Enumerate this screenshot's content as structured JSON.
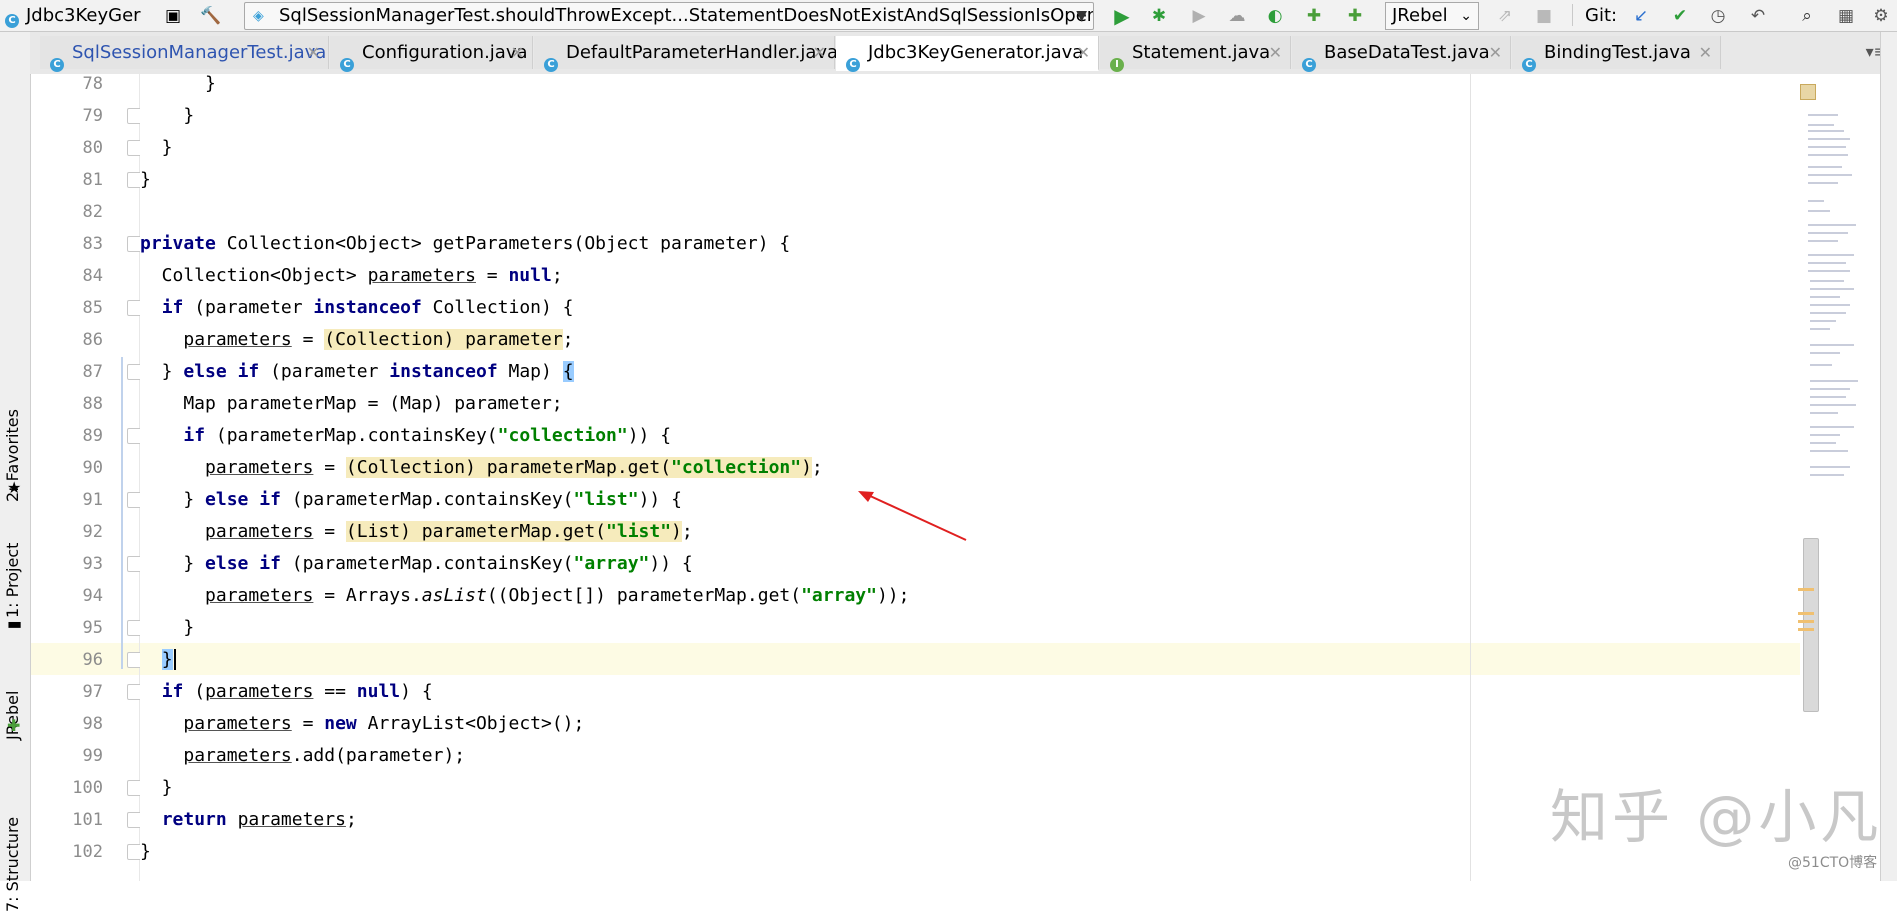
{
  "toolbar": {
    "window_title": "Jdbc3KeyGer",
    "run_config": "SqlSessionManagerTest.shouldThrowExcept...StatementDoesNotExistAndSqlSessionIsOpen",
    "jrebel_select": "JRebel",
    "git_label": "Git:"
  },
  "tabs": [
    {
      "label": "SqlSessionManagerTest.java",
      "icon": "class-icon",
      "active": false
    },
    {
      "label": "Configuration.java",
      "icon": "class-icon",
      "active": false
    },
    {
      "label": "DefaultParameterHandler.java",
      "icon": "class-icon",
      "active": false
    },
    {
      "label": "Jdbc3KeyGenerator.java",
      "icon": "class-icon",
      "active": true
    },
    {
      "label": "Statement.java",
      "icon": "interface-icon",
      "active": false
    },
    {
      "label": "BaseDataTest.java",
      "icon": "class-icon",
      "active": false
    },
    {
      "label": "BindingTest.java",
      "icon": "class-icon",
      "active": false
    }
  ],
  "left_tools": {
    "favorites": "2: Favorites",
    "project": "1: Project",
    "jrebel": "JRebel",
    "structure": "7: Structure"
  },
  "editor": {
    "current_line": 96,
    "lines": [
      {
        "n": "78",
        "text": "      }"
      },
      {
        "n": "79",
        "text": "    }"
      },
      {
        "n": "80",
        "text": "  }"
      },
      {
        "n": "81",
        "text": "}"
      },
      {
        "n": "82",
        "text": ""
      },
      {
        "n": "83",
        "text": "private Collection<Object> getParameters(Object parameter) {"
      },
      {
        "n": "84",
        "text": "  Collection<Object> parameters = null;"
      },
      {
        "n": "85",
        "text": "  if (parameter instanceof Collection) {"
      },
      {
        "n": "86",
        "text": "    parameters = (Collection) parameter;"
      },
      {
        "n": "87",
        "text": "  } else if (parameter instanceof Map) {"
      },
      {
        "n": "88",
        "text": "    Map parameterMap = (Map) parameter;"
      },
      {
        "n": "89",
        "text": "    if (parameterMap.containsKey(\"collection\")) {"
      },
      {
        "n": "90",
        "text": "      parameters = (Collection) parameterMap.get(\"collection\");"
      },
      {
        "n": "91",
        "text": "    } else if (parameterMap.containsKey(\"list\")) {"
      },
      {
        "n": "92",
        "text": "      parameters = (List) parameterMap.get(\"list\");"
      },
      {
        "n": "93",
        "text": "    } else if (parameterMap.containsKey(\"array\")) {"
      },
      {
        "n": "94",
        "text": "      parameters = Arrays.asList((Object[]) parameterMap.get(\"array\"));"
      },
      {
        "n": "95",
        "text": "    }"
      },
      {
        "n": "96",
        "text": "  }"
      },
      {
        "n": "97",
        "text": "  if (parameters == null) {"
      },
      {
        "n": "98",
        "text": "    parameters = new ArrayList<Object>();"
      },
      {
        "n": "99",
        "text": "    parameters.add(parameter);"
      },
      {
        "n": "100",
        "text": "  }"
      },
      {
        "n": "101",
        "text": "  return parameters;"
      },
      {
        "n": "102",
        "text": "}"
      }
    ]
  },
  "watermark": {
    "main": "知乎 @小凡",
    "sub": "@51CTO博客"
  },
  "colors": {
    "keyword": "#000080",
    "string": "#008000",
    "highlight": "#f6ebbc",
    "current_line": "#fdfbe4",
    "arrow": "#e02020"
  }
}
